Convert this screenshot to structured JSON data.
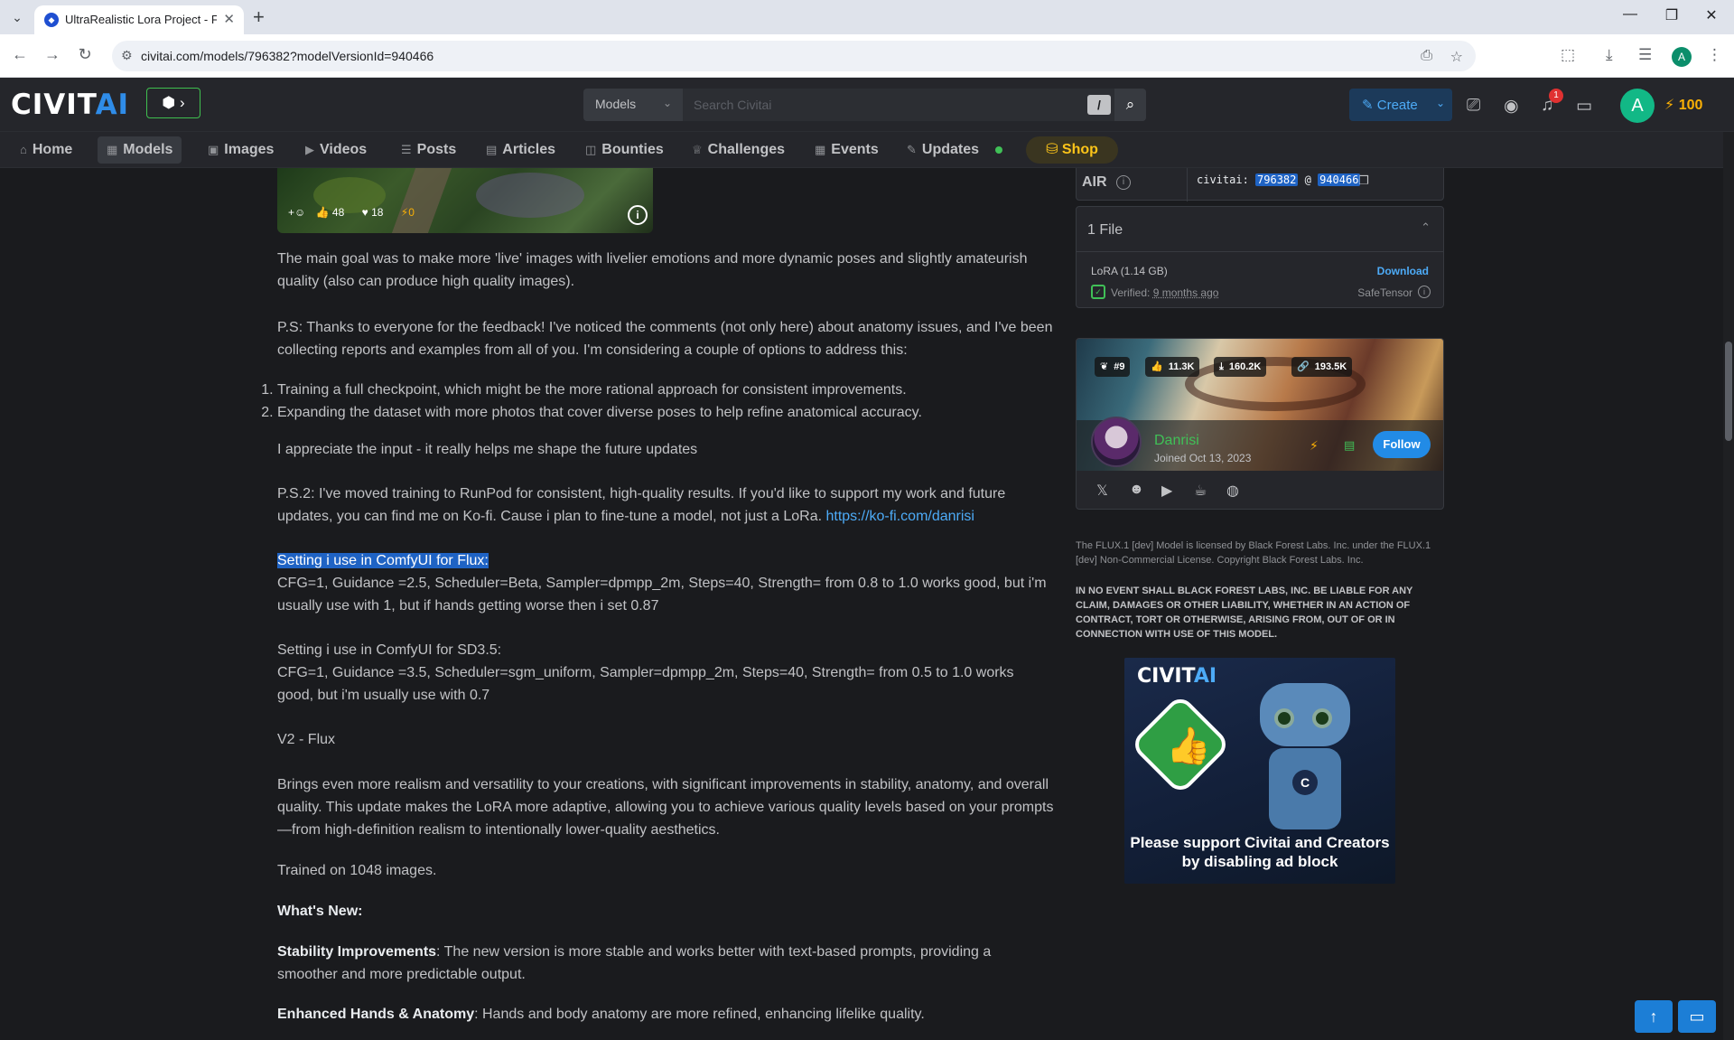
{
  "browser": {
    "tab_title": "UltraRealistic Lora Project - Flux",
    "url": "civitai.com/models/796382?modelVersionId=940466",
    "profile_initial": "A"
  },
  "header": {
    "logo_main": "CIVIT",
    "logo_accent": "AI",
    "search_scope": "Models",
    "search_placeholder": "Search Civitai",
    "search_hotkey": "/",
    "create_label": "Create",
    "notification_count": "1",
    "avatar_initial": "A",
    "buzz_amount": "100"
  },
  "nav": {
    "items": [
      {
        "label": "Home",
        "icon": "home-icon"
      },
      {
        "label": "Models",
        "icon": "grid-icon"
      },
      {
        "label": "Images",
        "icon": "photo-icon"
      },
      {
        "label": "Videos",
        "icon": "video-icon"
      },
      {
        "label": "Posts",
        "icon": "posts-icon"
      },
      {
        "label": "Articles",
        "icon": "article-icon"
      },
      {
        "label": "Bounties",
        "icon": "bounty-icon"
      },
      {
        "label": "Challenges",
        "icon": "trophy-icon"
      },
      {
        "label": "Events",
        "icon": "calendar-icon"
      },
      {
        "label": "Updates",
        "icon": "updates-icon"
      }
    ],
    "shop_label": "Shop"
  },
  "image_reactions": {
    "likes": "48",
    "hearts": "18",
    "buzz": "0"
  },
  "description": {
    "p1": "The main goal was to make more 'live' images with livelier emotions and more dynamic poses and slightly amateurish quality (also can produce high quality images).",
    "p2": "P.S: Thanks to everyone for the feedback! I've noticed the comments (not only here) about anatomy issues, and I've been collecting reports and examples from all of you. I'm considering a couple of options to address this:",
    "list": [
      "Training a full checkpoint, which might be the more rational approach for consistent improvements.",
      "Expanding the dataset with more photos that cover diverse poses to help refine anatomical accuracy."
    ],
    "p3": "I appreciate the input - it really helps me shape the future updates",
    "p4": "P.S.2: I've moved training to RunPod for consistent, high-quality results. If you'd like to support my work and future updates, you can find me on Ko-fi. Cause i plan to fine-tune a model, not just a LoRa.",
    "p4_link": "https://ko-fi.com/danrisi",
    "flux_heading": "Setting i use in ComfyUI for Flux:",
    "flux_settings": "CFG=1, Guidance =2.5, Scheduler=Beta, Sampler=dpmpp_2m, Steps=40, Strength= from 0.8 to 1.0 works good, but i'm usually use with 1, but if hands getting worse then i set 0.87",
    "sd35_heading": "Setting i use in ComfyUI for SD3.5:",
    "sd35_settings": "CFG=1, Guidance =3.5, Scheduler=sgm_uniform, Sampler=dpmpp_2m, Steps=40, Strength= from 0.5 to 1.0 works good, but i'm usually use with 0.7",
    "v2_heading": "V2 - Flux",
    "v2_text": "Brings even more realism and versatility to your creations, with significant improvements in stability, anatomy, and overall quality. This update makes the LoRA more adaptive, allowing you to achieve various quality levels based on your prompts—from high-definition realism to intentionally lower-quality aesthetics.",
    "trained": "Trained on 1048 images.",
    "whats_new": "What's New:",
    "stability_label": "Stability Improvements",
    "stability_text": ": The new version is more stable and works better with text-based prompts, providing a smoother and more predictable output.",
    "hands_label": "Enhanced Hands & Anatomy",
    "hands_text": ": Hands and body anatomy are more refined, enhancing lifelike quality."
  },
  "air": {
    "label": "AIR",
    "prefix": "civitai:",
    "model_id": "796382",
    "at": "@",
    "version_id": "940466"
  },
  "files": {
    "title": "1 File",
    "name": "LoRA (1.14 GB)",
    "download_label": "Download",
    "verified_prefix": "Verified:",
    "verified_when": "9 months ago",
    "format": "SafeTensor"
  },
  "creator": {
    "rank": "#9",
    "likes": "11.3K",
    "downloads": "160.2K",
    "links": "193.5K",
    "name": "Danrisi",
    "joined": "Joined Oct 13, 2023",
    "follow_label": "Follow"
  },
  "license": {
    "text": "The FLUX.1 [dev] Model is licensed by Black Forest Labs. Inc. under the FLUX.1 [dev] Non-Commercial License. Copyright Black Forest Labs. Inc.",
    "disclaimer": "IN NO EVENT SHALL BLACK FOREST LABS, INC. BE LIABLE FOR ANY CLAIM, DAMAGES OR OTHER LIABILITY, WHETHER IN AN ACTION OF CONTRACT, TORT OR OTHERWISE, ARISING FROM, OUT OF OR IN CONNECTION WITH USE OF THIS MODEL."
  },
  "ad": {
    "logo_main": "CIVIT",
    "logo_accent": "AI",
    "message": "Please support Civitai and Creators by disabling ad block"
  },
  "colors": {
    "accent_blue": "#228be6",
    "success_green": "#40c057",
    "buzz_yellow": "#fab005",
    "selection_blue": "#1f63c4"
  }
}
